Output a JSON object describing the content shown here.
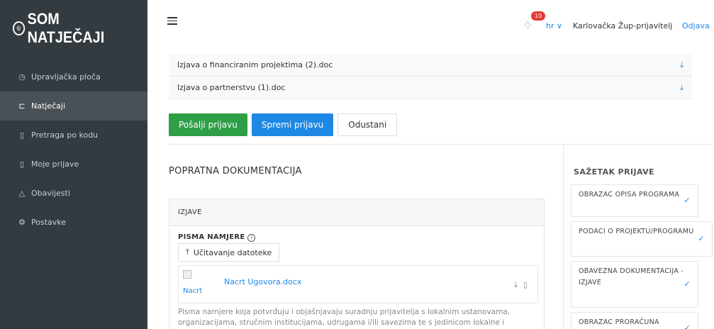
{
  "app": {
    "logo_text": "SOM NATJEČAJI",
    "logo_mark": "©"
  },
  "sidebar": {
    "items": [
      {
        "label": "Upravljačka ploča",
        "icon": "dashboard-icon",
        "glyph": "◷",
        "active": false
      },
      {
        "label": "Natječaji",
        "icon": "folder-icon",
        "glyph": "⊏",
        "active": true
      },
      {
        "label": "Pretraga po kodu",
        "icon": "document-icon",
        "glyph": "▯",
        "active": false
      },
      {
        "label": "Moje prijave",
        "icon": "file-icon",
        "glyph": "▯",
        "active": false
      },
      {
        "label": "Obavijesti",
        "icon": "bell-icon",
        "glyph": "△",
        "active": false
      },
      {
        "label": "Postavke",
        "icon": "gear-icon",
        "glyph": "⚙",
        "active": false
      }
    ]
  },
  "header": {
    "notification_count": "10",
    "language": "hr ∨",
    "user_name": "Karlovačka Žup-prijavitelj",
    "logout_label": "Odjava"
  },
  "files": [
    {
      "name": "Izjava o financiranim projektima (2).doc"
    },
    {
      "name": "Izjava o partnerstvu (1).doc"
    }
  ],
  "actions": {
    "submit_label": "Pošalji prijavu",
    "save_label": "Spremi prijavu",
    "cancel_label": "Odustani"
  },
  "documentation": {
    "title": "POPRATNA DOKUMENTACIJA",
    "card_title": "IZJAVE",
    "field_label": "PISMA NAMJERE",
    "upload_label": "Učitavanje datoteke",
    "thumb_label": "Nacrt",
    "document_name": "Nacrt Ugovora.docx",
    "description": "Pisma namjere koja potvrđuju i objašnjavaju suradnju prijavitelja s lokalnim ustanovama, organizacijama, stručnim institucijama, udrugama i/ili savezima te s jedinicom lokalne i"
  },
  "summary": {
    "title": "SAŽETAK PRIJAVE",
    "items": [
      {
        "label": "OBRAZAC OPISA PROGRAMA",
        "done": true
      },
      {
        "label": "PODACI O PROJEKTU/PROGRAMU",
        "done": true
      },
      {
        "label": "OBAVEZNA DOKUMENTACIJA - IZJAVE",
        "done": true
      },
      {
        "label": "OBRAZAC PRORAČUNA",
        "done": true
      }
    ]
  },
  "colors": {
    "sidebar": "#333b40",
    "accent": "#1e88e5",
    "success": "#2e9e47",
    "badge": "#e53935"
  }
}
